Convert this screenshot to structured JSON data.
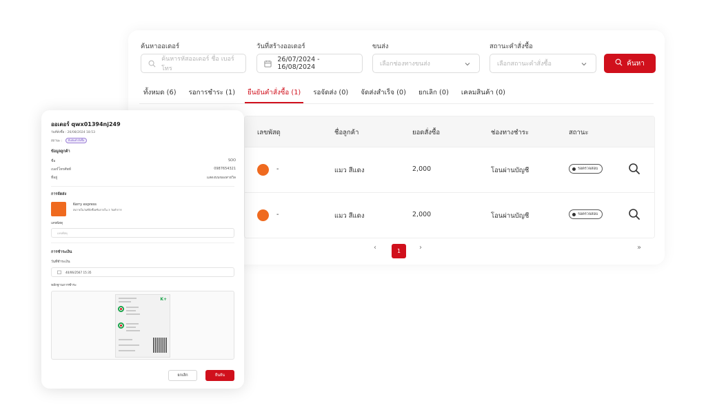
{
  "filters": {
    "search_label": "ค้นหาออเดอร์",
    "search_placeholder": "ค้นหารหัสออเดอร์ ชื่อ เบอร์โทร",
    "date_label": "วันที่สร้างออเดอร์",
    "date_value": "26/07/2024 - 16/08/2024",
    "shipping_label": "ขนส่ง",
    "shipping_placeholder": "เลือกช่องทางขนส่ง",
    "status_label": "สถานะคำสั่งซื้อ",
    "status_placeholder": "เลือกสถานะคำสั่งซื้อ",
    "search_button": "ค้นหา"
  },
  "tabs": [
    {
      "label": "ทั้งหมด (6)"
    },
    {
      "label": "รอการชำระ (1)"
    },
    {
      "label": "ยืนยันคำสั่งซื้อ (1)"
    },
    {
      "label": "รอจัดส่ง (0)"
    },
    {
      "label": "จัดส่งสำเร็จ (0)"
    },
    {
      "label": "ยกเลิก (0)"
    },
    {
      "label": "เคลมสินค้า (0)"
    }
  ],
  "active_tab_index": 2,
  "table": {
    "headers": [
      "เลขพัสดุ",
      "ชื่อลูกค้า",
      "ยอดสั่งซื้อ",
      "ช่องทางชำระ",
      "สถานะ"
    ],
    "rows": [
      {
        "tracking": "-",
        "customer": "แมว สีแดง",
        "amount": "2,000",
        "payment": "โอนผ่านบัญชี",
        "status": "รอตรวจสอบ"
      },
      {
        "tracking": "-",
        "customer": "แมว สีแดง",
        "amount": "2,000",
        "payment": "โอนผ่านบัญชี",
        "status": "รอตรวจสอบ"
      }
    ]
  },
  "pagination": {
    "prev": "‹",
    "current": "1",
    "next": "›",
    "last": "»"
  },
  "panel": {
    "title": "ออเดอร์ qwx01394nj249",
    "created": "วันที่สั่งซื้อ : 26/08/2024 18:53",
    "status_label": "สถานะ :",
    "status_badge": "ยืนยันคำสั่งซื้อ",
    "customer_section": "ข้อมูลลูกค้า",
    "name_label": "ชื่อ",
    "name_value": "SOO",
    "phone_label": "เบอร์โทรศัพท์",
    "phone_value": "0987654321",
    "address_label": "ที่อยู่",
    "address_value": "แสดงบนของสายวิล",
    "shipping_section": "การจัดส่ง",
    "courier_name": "Kerry express",
    "courier_desc": "ส่งภายในวันที่สั่งซื้อหรือภายใน 3 วันทำการ",
    "tracking_label": "เลขพัสดุ",
    "tracking_placeholder": "เลขพัสดุ",
    "payment_section": "การชำระเงิน",
    "pay_date_label": "วันที่ชำระเงิน",
    "pay_date_value": "40/06/2567 15:35",
    "proof_label": "หลักฐานการชำระ",
    "slip_brand": "K+",
    "cancel_button": "ยกเลิก",
    "confirm_button": "ยืนยัน"
  },
  "colors": {
    "accent": "#d0101c",
    "courier": "#ef6a1f"
  }
}
